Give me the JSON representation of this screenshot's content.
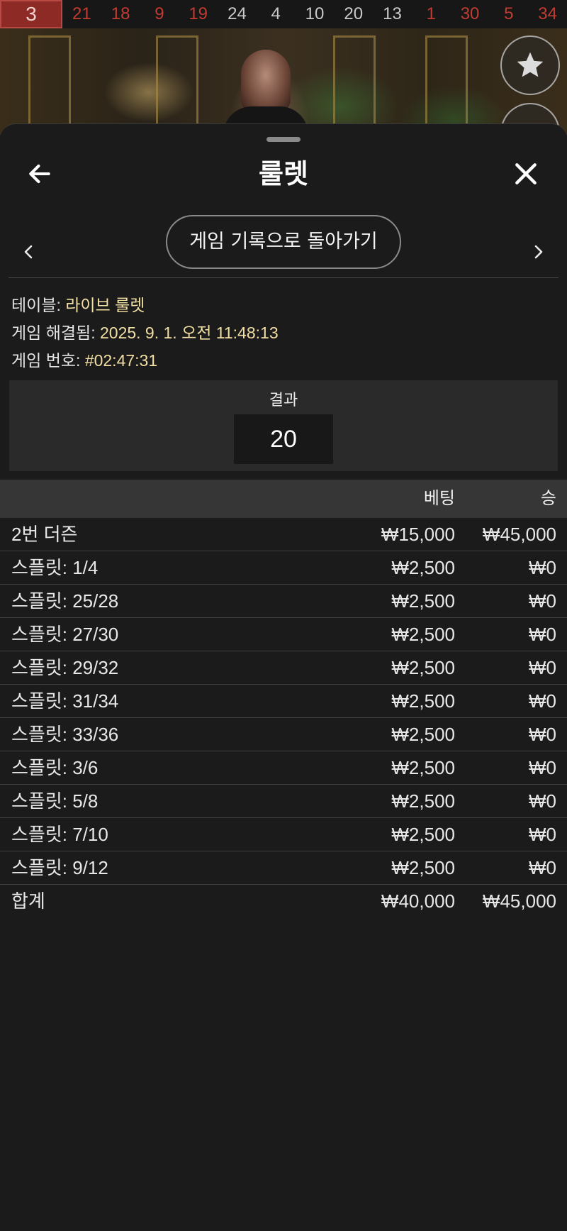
{
  "history_strip": [
    {
      "value": "3",
      "color": "red"
    },
    {
      "value": "21",
      "color": "red"
    },
    {
      "value": "18",
      "color": "red"
    },
    {
      "value": "9",
      "color": "red"
    },
    {
      "value": "19",
      "color": "red"
    },
    {
      "value": "24",
      "color": "black"
    },
    {
      "value": "4",
      "color": "black"
    },
    {
      "value": "10",
      "color": "black"
    },
    {
      "value": "20",
      "color": "black"
    },
    {
      "value": "13",
      "color": "black"
    },
    {
      "value": "1",
      "color": "red"
    },
    {
      "value": "30",
      "color": "red"
    },
    {
      "value": "5",
      "color": "red"
    },
    {
      "value": "34",
      "color": "red"
    }
  ],
  "icons": {
    "favorite": "star-icon",
    "info": "info-icon",
    "back": "arrow-left-icon",
    "close": "close-icon",
    "prev": "chevron-left-icon",
    "next": "chevron-right-icon"
  },
  "header": {
    "title": "룰렛"
  },
  "nav": {
    "back_to_history": "게임 기록으로 돌아가기"
  },
  "details": {
    "table_label": "테이블:",
    "table_value": "라이브 룰렛",
    "resolved_label": "게임 해결됨:",
    "resolved_value": "2025. 9. 1. 오전 11:48:13",
    "game_no_label": "게임 번호:",
    "game_no_value": "#02:47:31"
  },
  "result": {
    "label": "결과",
    "value": "20"
  },
  "bets_table": {
    "columns": {
      "name": "",
      "bet": "베팅",
      "win": "승"
    },
    "rows": [
      {
        "name": "2번 더즌",
        "bet": "₩15,000",
        "win": "₩45,000"
      },
      {
        "name": "스플릿: 1/4",
        "bet": "₩2,500",
        "win": "₩0"
      },
      {
        "name": "스플릿: 25/28",
        "bet": "₩2,500",
        "win": "₩0"
      },
      {
        "name": "스플릿: 27/30",
        "bet": "₩2,500",
        "win": "₩0"
      },
      {
        "name": "스플릿: 29/32",
        "bet": "₩2,500",
        "win": "₩0"
      },
      {
        "name": "스플릿: 31/34",
        "bet": "₩2,500",
        "win": "₩0"
      },
      {
        "name": "스플릿: 33/36",
        "bet": "₩2,500",
        "win": "₩0"
      },
      {
        "name": "스플릿: 3/6",
        "bet": "₩2,500",
        "win": "₩0"
      },
      {
        "name": "스플릿: 5/8",
        "bet": "₩2,500",
        "win": "₩0"
      },
      {
        "name": "스플릿: 7/10",
        "bet": "₩2,500",
        "win": "₩0"
      },
      {
        "name": "스플릿: 9/12",
        "bet": "₩2,500",
        "win": "₩0"
      }
    ],
    "total": {
      "name": "합계",
      "bet": "₩40,000",
      "win": "₩45,000"
    }
  },
  "colors": {
    "red_number": "#c23b32",
    "black_number": "#c9c9c9",
    "highlight_value": "#f1dfa3",
    "sheet_bg": "#1b1b1b"
  }
}
